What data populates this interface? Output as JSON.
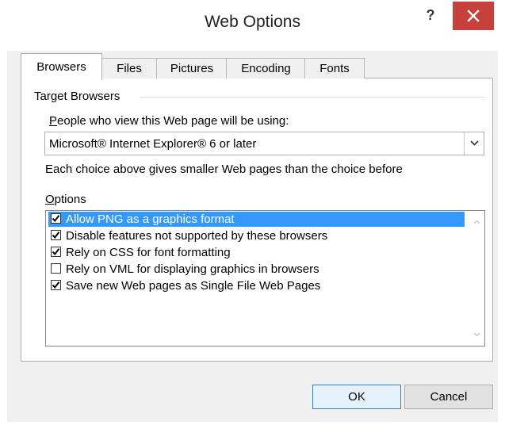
{
  "window": {
    "title": "Web Options",
    "help_label": "?"
  },
  "tabs": [
    {
      "label": "Browsers",
      "active": true
    },
    {
      "label": "Files",
      "active": false
    },
    {
      "label": "Pictures",
      "active": false
    },
    {
      "label": "Encoding",
      "active": false
    },
    {
      "label": "Fonts",
      "active": false
    }
  ],
  "target_browsers": {
    "group_label": "Target Browsers",
    "field_label_first": "P",
    "field_label_rest": "eople who view this Web page will be using:",
    "selected_value": "Microsoft® Internet Explorer® 6 or later",
    "hint": "Each choice above gives smaller Web pages than the choice before"
  },
  "options": {
    "label_first": "O",
    "label_rest": "ptions",
    "items": [
      {
        "label": "Allow PNG as a graphics format",
        "checked": true,
        "selected": true
      },
      {
        "label": "Disable features not supported by these browsers",
        "checked": true,
        "selected": false
      },
      {
        "label": "Rely on CSS for font formatting",
        "checked": true,
        "selected": false
      },
      {
        "label": "Rely on VML for displaying graphics in browsers",
        "checked": false,
        "selected": false
      },
      {
        "label": "Save new Web pages as Single File Web Pages",
        "checked": true,
        "selected": false
      }
    ]
  },
  "buttons": {
    "ok": "OK",
    "cancel": "Cancel"
  },
  "colors": {
    "close_button": "#c7413a",
    "selection": "#3399ff",
    "dialog_bg": "#f0f0f0"
  }
}
